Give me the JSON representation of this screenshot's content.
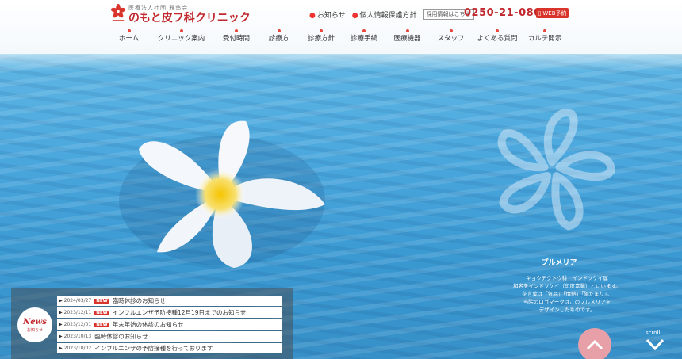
{
  "header": {
    "logo_sub": "医療法人社団 雅悠会",
    "logo_name": "のもと皮フ科クリニック",
    "top_links": [
      {
        "label": "お知らせ"
      },
      {
        "label": "個人情報保護方針"
      }
    ],
    "recruit_label": "採用情報はこちら",
    "phone": "0250-21-0800",
    "web_button": "WEB予約",
    "nav": [
      "ホーム",
      "クリニック案内",
      "受付時間",
      "診療方",
      "診療方針",
      "診療手続",
      "医療機器",
      "スタッフ",
      "よくある質問",
      "カルテ開示"
    ]
  },
  "plumeria": {
    "title": "プルメリア",
    "description": [
      "キョウチクトウ科　インドソケイ属",
      "和名をインドソケイ（印度素馨）といいます。",
      "花言葉は「気品」「情熱」「陽だまり」。",
      "当院のロゴマークはこのプルメリアを",
      "デザインしたものです。"
    ]
  },
  "news": {
    "badge_main": "News",
    "badge_sub": "お知らせ",
    "items": [
      {
        "date": "2024/03/27",
        "is_new": true,
        "new_label": "NEW",
        "title": "臨時休診のお知らせ"
      },
      {
        "date": "2023/12/11",
        "is_new": true,
        "new_label": "NEW",
        "title": "インフルエンザ予防接種12月19日までのお知らせ"
      },
      {
        "date": "2023/12/01",
        "is_new": true,
        "new_label": "NEW",
        "title": "年末年始の休診のお知らせ"
      },
      {
        "date": "2023/10/13",
        "is_new": false,
        "new_label": "",
        "title": "臨時休診のお知らせ"
      },
      {
        "date": "2023/10/02",
        "is_new": false,
        "new_label": "",
        "title": "インフルエンザの予防接種を行っております"
      }
    ]
  },
  "scroll_label": "scroll",
  "colors": {
    "brand_red": "#c1272d",
    "accent_red": "#d9342b",
    "water": "#4aa7dd",
    "pagetop": "#e7a0a8"
  }
}
